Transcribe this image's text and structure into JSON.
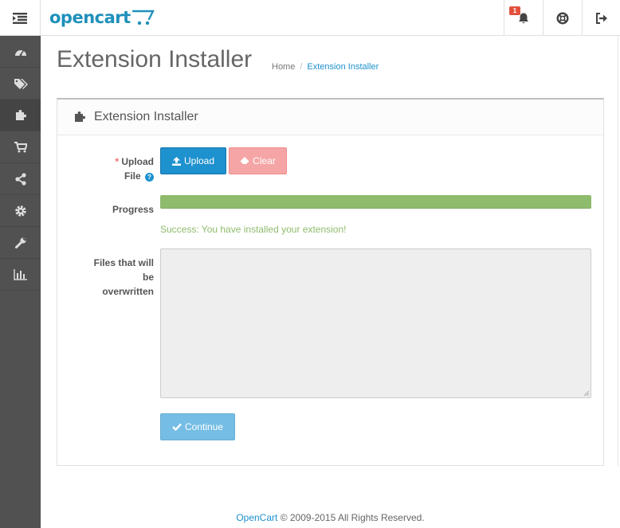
{
  "header": {
    "logo_text": "opencart",
    "notification_count": "1",
    "icons": [
      "menu-toggle-icon",
      "bell-icon",
      "life-ring-icon",
      "sign-out-icon"
    ]
  },
  "sidebar": {
    "items": [
      {
        "icon": "dashboard-icon"
      },
      {
        "icon": "tags-icon"
      },
      {
        "icon": "puzzle-icon",
        "active": true
      },
      {
        "icon": "shopping-cart-icon"
      },
      {
        "icon": "share-icon"
      },
      {
        "icon": "cog-icon"
      },
      {
        "icon": "wrench-icon"
      },
      {
        "icon": "bar-chart-icon"
      }
    ]
  },
  "page": {
    "title": "Extension Installer",
    "breadcrumb": {
      "home": "Home",
      "separator": "/",
      "current": "Extension Installer"
    }
  },
  "panel": {
    "heading": "Extension Installer",
    "upload_label_req": "*",
    "upload_label_1": "Upload",
    "upload_label_2": "File",
    "help_icon": "?",
    "upload_button": "Upload",
    "clear_button": "Clear",
    "progress_label": "Progress",
    "progress_value": 1.0,
    "success_message": "Success: You have installed your extension!",
    "overwrite_label_1": "Files that will",
    "overwrite_label_2": "be",
    "overwrite_label_3": "overwritten",
    "continue_button": "Continue"
  },
  "footer": {
    "link": "OpenCart",
    "text": "© 2009-2015 All Rights Reserved."
  },
  "colors": {
    "brand": "#1e91cf",
    "success": "#8fbb6c",
    "danger_light": "#f5a5a5",
    "sidebar_bg": "#515151"
  }
}
